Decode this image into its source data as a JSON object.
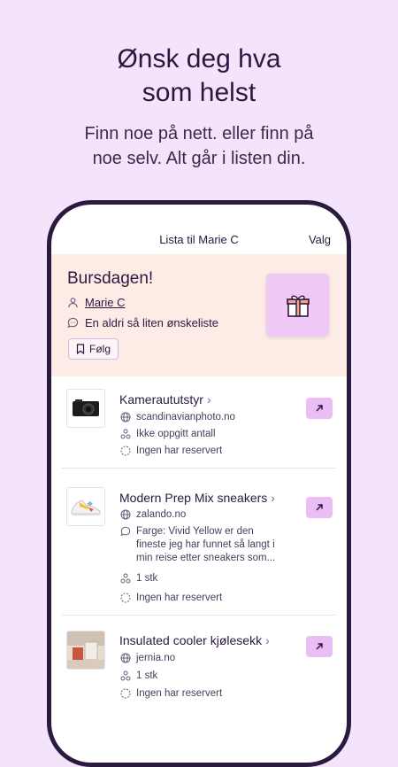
{
  "hero": {
    "title_line1": "Ønsk deg hva",
    "title_line2": "som helst",
    "subtitle_line1": "Finn noe på nett. eller finn på",
    "subtitle_line2": "noe selv. Alt går i listen din."
  },
  "nav": {
    "title": "Lista til Marie C",
    "menu_label": "Valg"
  },
  "wishlist": {
    "title": "Bursdagen!",
    "owner": "Marie C",
    "description": "En aldri så liten ønskeliste",
    "follow_label": "Følg"
  },
  "items": [
    {
      "name": "Kameraututstyr",
      "store": "scandinavianphoto.no",
      "quantity": "Ikke oppgitt antall",
      "reservation": "Ingen har reservert"
    },
    {
      "name": "Modern Prep Mix sneakers",
      "store": "zalando.no",
      "comment_line1": "Farge: Vivid Yellow er den",
      "comment_line2": "fineste jeg har funnet så langt i",
      "comment_line3": "min reise etter sneakers som...",
      "quantity": "1 stk",
      "reservation": "Ingen har reservert"
    },
    {
      "name": "Insulated cooler kjølesekk",
      "store": "jernia.no",
      "quantity": "1 stk",
      "reservation": "Ingen har reservert"
    }
  ],
  "colors": {
    "background": "#f4e4fb",
    "header_card": "#fdece6",
    "accent": "#eabef5",
    "text": "#2a1840"
  }
}
